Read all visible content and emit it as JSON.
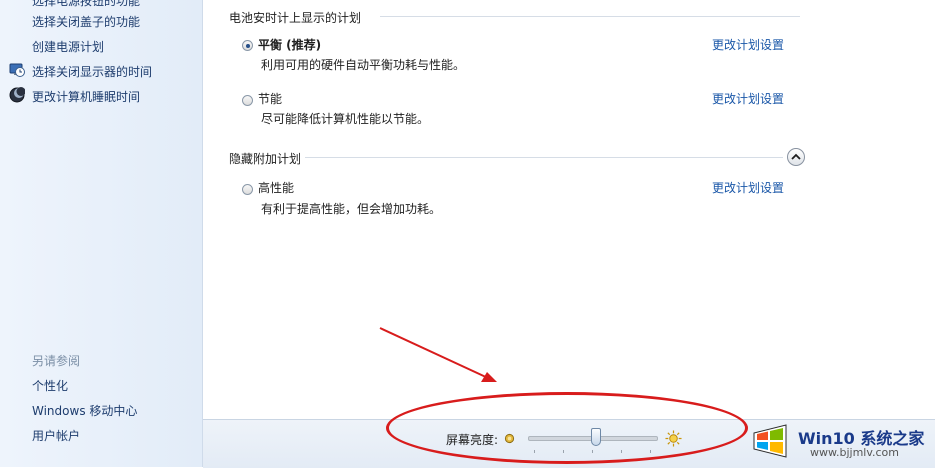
{
  "sidebar": {
    "links": [
      {
        "label": "选择电源按钮的功能"
      },
      {
        "label": "选择关闭盖子的功能"
      },
      {
        "label": "创建电源计划"
      },
      {
        "label": "选择关闭显示器的时间",
        "icon": "monitor-clock-icon"
      },
      {
        "label": "更改计算机睡眠时间",
        "icon": "moon-icon"
      }
    ],
    "see_also_header": "另请参阅",
    "see_also": [
      {
        "label": "个性化"
      },
      {
        "label": "Windows 移动中心"
      },
      {
        "label": "用户帐户"
      }
    ]
  },
  "main": {
    "battery_section_title": "电池安时计上显示的计划",
    "hidden_section_title": "隐藏附加计划",
    "plans": [
      {
        "name": "平衡 (推荐)",
        "desc": "利用可用的硬件自动平衡功耗与性能。",
        "selected": true,
        "link": "更改计划设置"
      },
      {
        "name": "节能",
        "desc": "尽可能降低计算机性能以节能。",
        "selected": false,
        "link": "更改计划设置"
      },
      {
        "name": "高性能",
        "desc": "有利于提高性能，但会增加功耗。",
        "selected": false,
        "link": "更改计划设置"
      }
    ]
  },
  "brightness": {
    "label": "屏幕亮度:",
    "value_fraction": 0.53,
    "dim_icon": "dim-sun-icon",
    "bright_icon": "bright-sun-icon"
  },
  "annotation": {
    "color": "#d81c1c"
  },
  "watermark": {
    "title": "Win10 系统之家",
    "site": "www.bjjmlv.com"
  }
}
